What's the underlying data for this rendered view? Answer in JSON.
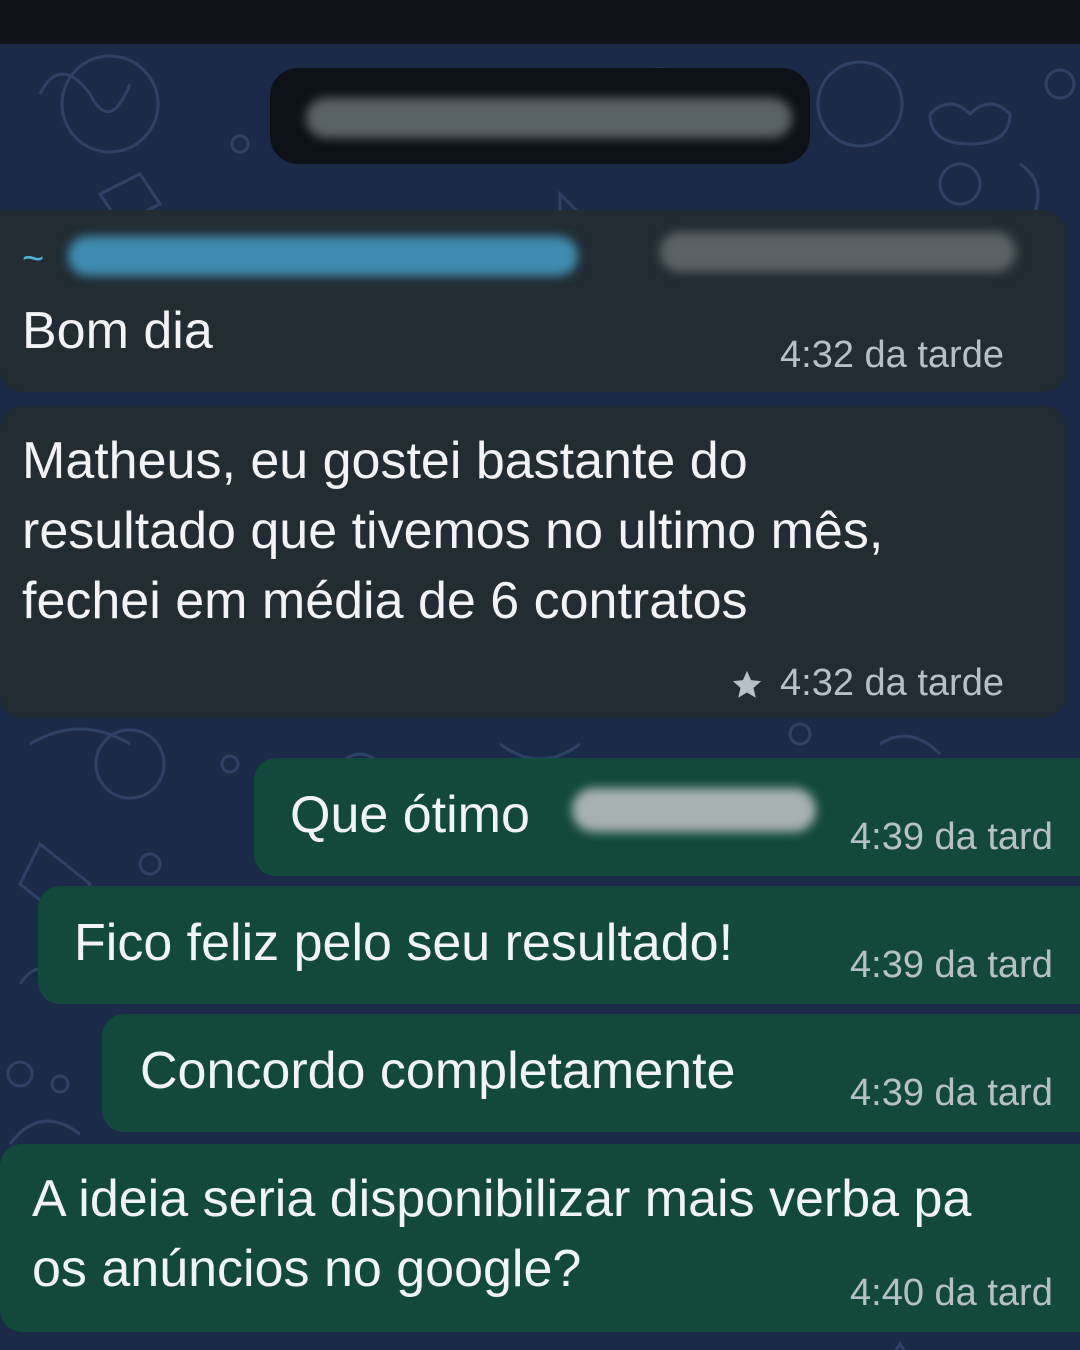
{
  "chat": {
    "incoming": [
      {
        "sender_prefix": "~",
        "text": "Bom dia",
        "time": "4:32 da tarde"
      },
      {
        "lines": [
          "Matheus, eu gostei bastante do",
          "resultado que tivemos no ultimo mês,",
          "fechei em média de 6 contratos"
        ],
        "time": "4:32 da tarde",
        "starred": true,
        "star_icon": "star-icon"
      }
    ],
    "outgoing": [
      {
        "text": "Que ótimo",
        "time": "4:39 da tard"
      },
      {
        "text": "Fico feliz pelo seu resultado!",
        "time": "4:39 da tard"
      },
      {
        "text": "Concordo completamente",
        "time": "4:39 da tard"
      },
      {
        "lines": [
          "A ideia seria disponibilizar mais verba pa",
          "os anúncios no google?"
        ],
        "time": "4:40 da tard"
      }
    ]
  },
  "colors": {
    "wallpaper": "#1b2a47",
    "incoming_bubble": "#212c33",
    "outgoing_bubble": "#12493a",
    "sender_name": "#4fb3d9",
    "timestamp": "#b7c0c6"
  }
}
